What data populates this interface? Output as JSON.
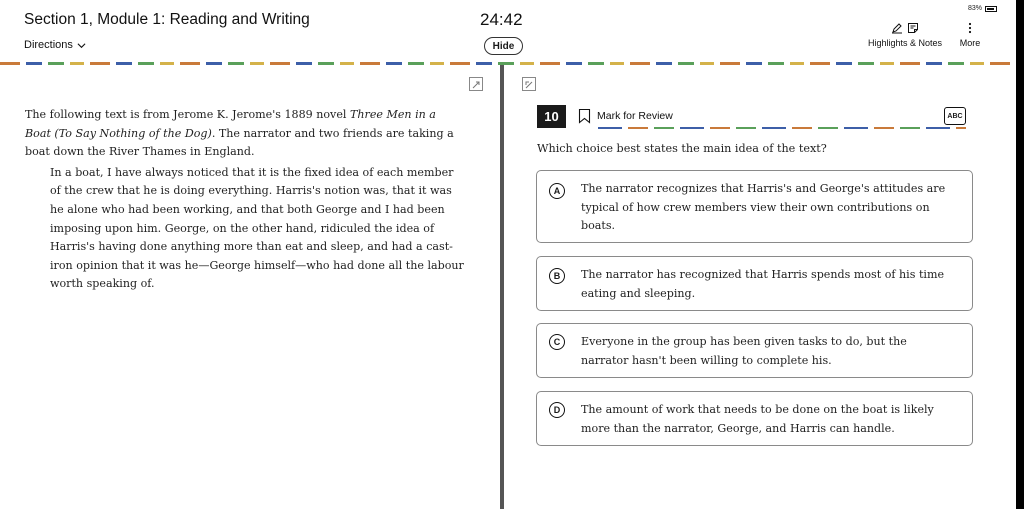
{
  "header": {
    "section_title": "Section 1, Module 1: Reading and Writing",
    "directions_label": "Directions",
    "timer": "24:42",
    "hide_label": "Hide",
    "battery": "83%",
    "highlights_label": "Highlights & Notes",
    "more_label": "More"
  },
  "passage": {
    "intro_prefix": "The following text is from Jerome K. Jerome's 1889 novel ",
    "intro_title": "Three Men in a Boat (To Say Nothing of the Dog)",
    "intro_suffix": ". The narrator and two friends are taking a boat down the River Thames in England.",
    "excerpt": "In a boat, I have always noticed that it is the fixed idea of each member of the crew that he is doing everything. Harris's notion was, that it was he alone who had been working, and that both George and I had been imposing upon him. George, on the other hand, ridiculed the idea of Harris's having done anything more than eat and sleep, and had a cast-iron opinion that it was he—George himself—who had done all the labour worth speaking of."
  },
  "question": {
    "number": "10",
    "mark_label": "Mark for Review",
    "abc_label": "ABC",
    "prompt": "Which choice best states the main idea of the text?",
    "choices": [
      {
        "letter": "A",
        "text": "The narrator recognizes that Harris's and George's attitudes are typical of how crew members view their own contributions on boats."
      },
      {
        "letter": "B",
        "text": "The narrator has recognized that Harris spends most of his time eating and sleeping."
      },
      {
        "letter": "C",
        "text": "Everyone in the group has been given tasks to do, but the narrator hasn't been willing to complete his."
      },
      {
        "letter": "D",
        "text": "The amount of work that needs to be done on the boat is likely more than the narrator, George, and Harris can handle."
      }
    ]
  }
}
